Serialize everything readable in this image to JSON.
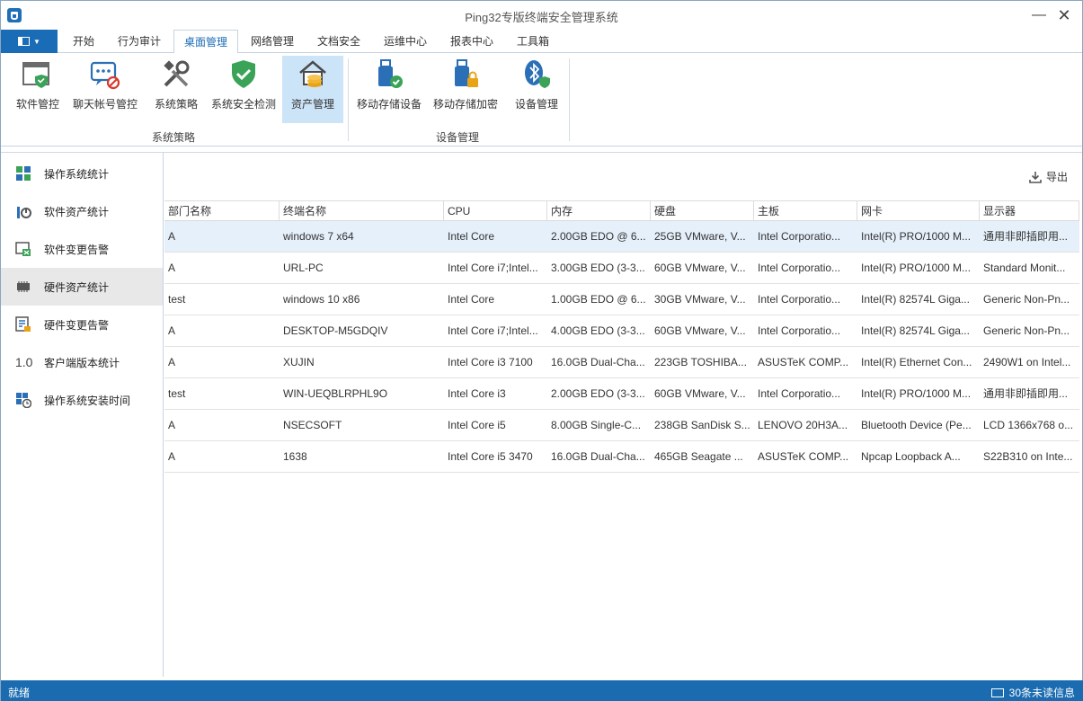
{
  "window": {
    "title": "Ping32专版终端安全管理系统"
  },
  "menu": {
    "tabs": [
      "开始",
      "行为审计",
      "桌面管理",
      "网络管理",
      "文档安全",
      "运维中心",
      "报表中心",
      "工具箱"
    ],
    "active": "桌面管理"
  },
  "ribbon": {
    "buttons": [
      "软件管控",
      "聊天帐号管控",
      "系统策略",
      "系统安全检测",
      "资产管理",
      "移动存储设备",
      "移动存储加密",
      "设备管理"
    ],
    "groups": [
      "系统策略",
      "设备管理"
    ]
  },
  "sidebar": {
    "items": [
      "操作系统统计",
      "软件资产统计",
      "软件变更告警",
      "硬件资产统计",
      "硬件变更告警",
      "客户端版本统计",
      "操作系统安装时间"
    ],
    "selected": "硬件资产统计",
    "version_glyph": "1.0"
  },
  "toolbar": {
    "export_label": "导出"
  },
  "table": {
    "columns": [
      "部门名称",
      "终端名称",
      "CPU",
      "内存",
      "硬盘",
      "主板",
      "网卡",
      "显示器"
    ],
    "rows": [
      [
        "A",
        "windows 7 x64",
        "Intel Core",
        "2.00GB EDO @ 6...",
        "25GB VMware, V...",
        "Intel Corporatio...",
        "Intel(R) PRO/1000 M...",
        "通用非即插即用..."
      ],
      [
        "A",
        "URL-PC",
        "Intel Core i7;Intel...",
        "3.00GB EDO (3-3...",
        "60GB VMware, V...",
        "Intel Corporatio...",
        "Intel(R) PRO/1000 M...",
        "Standard Monit..."
      ],
      [
        "test",
        "windows 10 x86",
        "Intel Core",
        "1.00GB EDO @ 6...",
        "30GB VMware, V...",
        "Intel Corporatio...",
        "Intel(R) 82574L Giga...",
        "Generic Non-Pn..."
      ],
      [
        "A",
        "DESKTOP-M5GDQIV",
        "Intel Core i7;Intel...",
        "4.00GB EDO (3-3...",
        "60GB VMware, V...",
        "Intel Corporatio...",
        "Intel(R) 82574L Giga...",
        "Generic Non-Pn..."
      ],
      [
        "A",
        "XUJIN",
        "Intel Core i3 7100",
        "16.0GB Dual-Cha...",
        "223GB TOSHIBA...",
        "ASUSTeK COMP...",
        "Intel(R) Ethernet Con...",
        "2490W1 on Intel..."
      ],
      [
        "test",
        "WIN-UEQBLRPHL9O",
        "Intel Core i3",
        "2.00GB EDO (3-3...",
        "60GB VMware, V...",
        "Intel Corporatio...",
        "Intel(R) PRO/1000 M...",
        "通用非即插即用..."
      ],
      [
        "A",
        "NSECSOFT",
        "Intel Core i5",
        "8.00GB Single-C...",
        "238GB SanDisk S...",
        "LENOVO 20H3A...",
        "Bluetooth Device (Pe...",
        "LCD 1366x768 o..."
      ],
      [
        "A",
        "1638",
        "Intel Core i5 3470",
        "16.0GB Dual-Cha...",
        "465GB Seagate ...",
        "ASUSTeK COMP...",
        "Npcap Loopback A...",
        "S22B310 on Inte..."
      ]
    ]
  },
  "status": {
    "left": "就绪",
    "right": "30条未读信息"
  },
  "colors": {
    "accent": "#1b6cb6",
    "selected_ribbon": "#cce4f7",
    "status_bar": "#1a6bb0"
  }
}
